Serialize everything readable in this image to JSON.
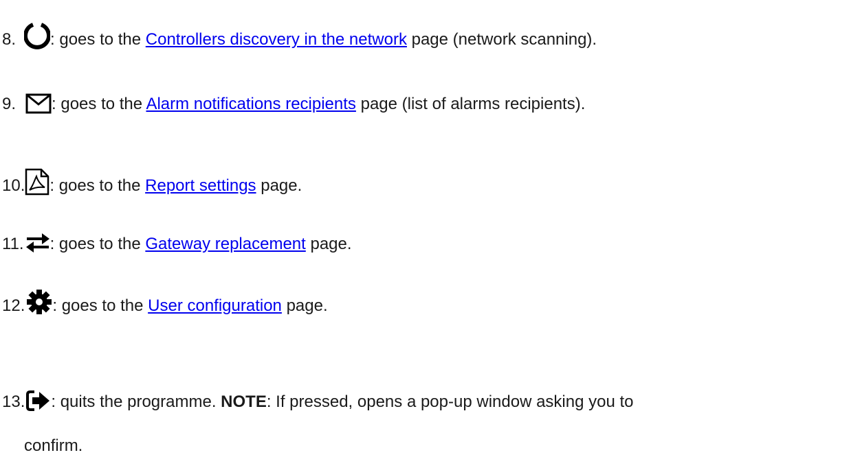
{
  "items": [
    {
      "number": "8.",
      "icon": "circle-notch-icon",
      "prefix": ": goes to the ",
      "link": "Controllers discovery in the network",
      "suffix": " page (network scanning)."
    },
    {
      "number": "9.",
      "icon": "envelope-icon",
      "prefix": ": goes to the ",
      "link": "Alarm notifications recipients",
      "suffix": " page (list of alarms recipients)."
    },
    {
      "number": "10.",
      "icon": "pdf-file-icon",
      "prefix": ": goes to the ",
      "link": "Report settings",
      "suffix": " page."
    },
    {
      "number": "11.",
      "icon": "exchange-arrows-icon",
      "prefix": ": goes to the ",
      "link": "Gateway replacement",
      "suffix": " page."
    },
    {
      "number": "12.",
      "icon": "gear-icon",
      "prefix": ": goes to the ",
      "link": "User configuration",
      "suffix": " page."
    },
    {
      "number": "13.",
      "icon": "sign-out-icon",
      "prefix": ": quits the programme. ",
      "note_label": "NOTE",
      "note_text": ": If pressed, opens a pop-up window asking you to",
      "continuation": "confirm."
    }
  ]
}
